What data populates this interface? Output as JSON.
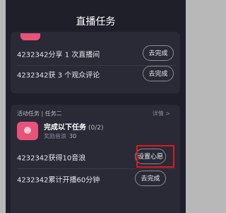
{
  "header": {
    "title": "直播任务"
  },
  "tasks_top": [
    {
      "label": "4232342分享 1 次直播间",
      "button": "去完成"
    },
    {
      "label": "4232342获 3 个观众评论",
      "button": "去完成"
    }
  ],
  "group": {
    "section_label": "活动任务 | 任务二",
    "detail_label": "详情 >",
    "title": "完成以下任务",
    "count": "(0/2)",
    "reward_label": "奖励音浪",
    "reward_value": "30"
  },
  "tasks_bottom": [
    {
      "label": "4232342获得10音浪",
      "button": "设置心愿"
    },
    {
      "label": "4232342累计开播60分钟",
      "button": "去完成"
    }
  ],
  "colors": {
    "panel": "#1f1f2a",
    "card": "#2a2a36",
    "accent": "#e8537a",
    "highlight": "#e01818"
  }
}
